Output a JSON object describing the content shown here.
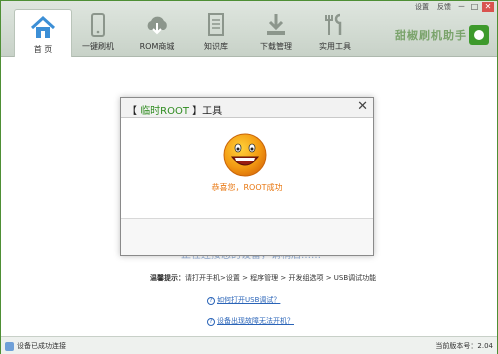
{
  "window_controls": {
    "settings": "设置",
    "feedback": "反馈",
    "minimize": "－",
    "maximize": "□",
    "close": "✕"
  },
  "tabs": [
    {
      "label": "首 页",
      "icon": "home-icon"
    },
    {
      "label": "一键刷机",
      "icon": "phone-icon"
    },
    {
      "label": "ROM商城",
      "icon": "cloud-download-icon"
    },
    {
      "label": "知识库",
      "icon": "document-icon"
    },
    {
      "label": "下载管理",
      "icon": "download-icon"
    },
    {
      "label": "实用工具",
      "icon": "tools-icon"
    }
  ],
  "brand": {
    "name": "甜椒刷机助手"
  },
  "background": {
    "heading": "正在连接您的设备，请稍后……",
    "tip_label": "温馨提示：",
    "tip_text": "请打开手机>设置 > 程序管理 > 开发组选项 > USB调试功能",
    "link1": "如何打开USB调试？",
    "link2": "设备出现故障无法开机？",
    "link_icon": "?"
  },
  "dialog": {
    "title_prefix": "【 ",
    "title_highlight": "临时ROOT",
    "title_suffix": " 】工具",
    "close": "✕",
    "message": "恭喜您，ROOT成功"
  },
  "statusbar": {
    "left": "设备已成功连接",
    "right": "当前版本号：2.04"
  },
  "colors": {
    "accent": "#2e8b1f",
    "success_text": "#e8760f",
    "link": "#2a64b8"
  }
}
